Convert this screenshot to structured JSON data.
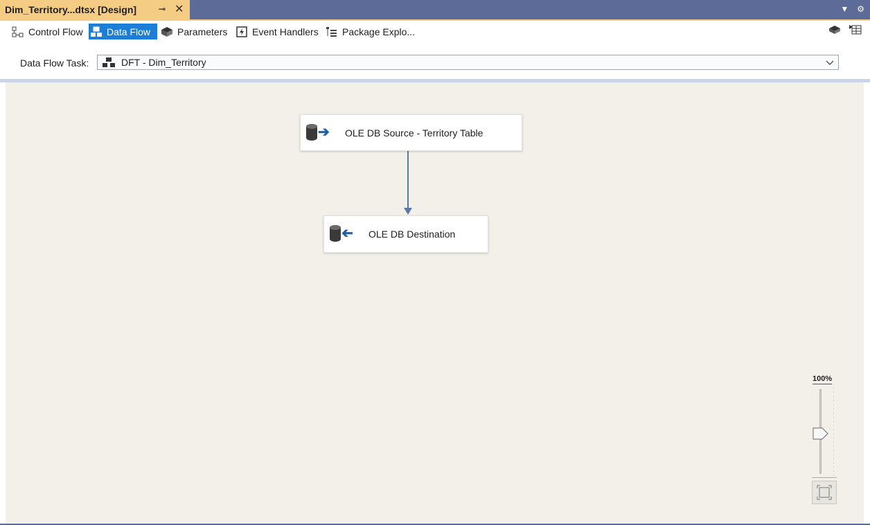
{
  "document_tab": {
    "title": "Dim_Territory...dtsx [Design]",
    "pin_glyph": "⊸",
    "close_glyph": "✕"
  },
  "designer_tabs": [
    {
      "label": "Control Flow",
      "icon": "control-flow-icon",
      "active": false
    },
    {
      "label": "Data Flow",
      "icon": "data-flow-icon",
      "active": true
    },
    {
      "label": "Parameters",
      "icon": "parameters-icon",
      "active": false
    },
    {
      "label": "Event Handlers",
      "icon": "event-handlers-icon",
      "active": false
    },
    {
      "label": "Package Explo...",
      "icon": "package-explorer-icon",
      "active": false
    }
  ],
  "task_selector": {
    "label": "Data Flow Task:",
    "value": "DFT - Dim_Territory"
  },
  "canvas": {
    "background": "#f3f0e9",
    "nodes": [
      {
        "label": "OLE DB Source - Territory Table",
        "icon": "ole-db-source-icon"
      },
      {
        "label": "OLE DB Destination",
        "icon": "ole-db-destination-icon"
      }
    ],
    "connector_color": "#5a79a8"
  },
  "zoom": {
    "label": "100%"
  },
  "colors": {
    "tab_gold": "#f5cc84",
    "chrome_blue": "#5d6b99",
    "active_tab": "#1c7ed6"
  }
}
